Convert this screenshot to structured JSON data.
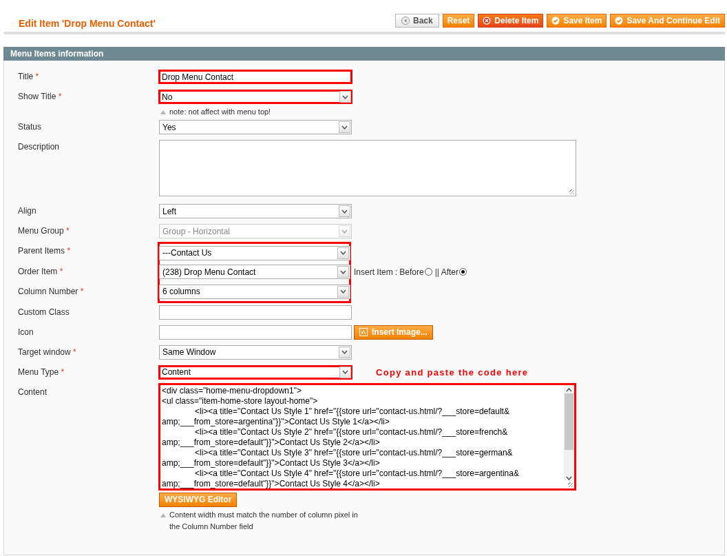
{
  "header": {
    "title": "Edit Item 'Drop Menu Contact'",
    "buttons": [
      {
        "label": "Back",
        "kind": "back"
      },
      {
        "label": "Reset",
        "kind": "plain"
      },
      {
        "label": "Delete Item",
        "kind": "delete"
      },
      {
        "label": "Save Item",
        "kind": "save"
      },
      {
        "label": "Save And Continue Edit",
        "kind": "save"
      }
    ]
  },
  "section": {
    "title": "Menu Items information",
    "rows": [
      {
        "kind": "text",
        "label": "Title",
        "marker": "*",
        "value": "Drop Menu Contact",
        "highlighted": true
      },
      {
        "kind": "select",
        "label": "Show Title",
        "marker": "*",
        "value": "No",
        "highlighted": true,
        "note": "note: not affect with menu top!"
      },
      {
        "kind": "select",
        "label": "Status",
        "value": "Yes",
        "highlighted": false
      },
      {
        "kind": "textarea",
        "label": "Description",
        "highlighted": false
      },
      {
        "kind": "select",
        "label": "Align",
        "value": "Left",
        "highlighted": false
      },
      {
        "kind": "select",
        "label": "Menu Group",
        "marker": "*",
        "value": "Group - Horizontal",
        "highlighted": false,
        "disabled": true
      },
      {
        "kind": "group",
        "highlighted": true,
        "rows": [
          {
            "kind": "select",
            "label": "Parent Items",
            "marker": "*",
            "value": "---Contact Us"
          },
          {
            "kind": "select",
            "label": "Order Item",
            "marker": "*",
            "value": "(238) Drop Menu Contact",
            "insert": {
              "label": "Insert Item :",
              "options": [
                {
                  "label": "Before",
                  "selected": false
                },
                {
                  "label": "|| After",
                  "selected": true
                }
              ]
            }
          },
          {
            "kind": "select",
            "label": "Column Number",
            "marker": "*",
            "value": "6 columns"
          }
        ]
      },
      {
        "kind": "text",
        "label": "Custom Class",
        "value": "",
        "highlighted": false
      },
      {
        "kind": "image",
        "label": "Icon",
        "value": "",
        "highlighted": false,
        "button": "Insert Image..."
      },
      {
        "kind": "select",
        "label": "Target window",
        "marker": "*",
        "value": "Same Window",
        "highlighted": false
      },
      {
        "kind": "select",
        "label": "Menu Type",
        "marker": "*",
        "value": "Content",
        "highlighted": true,
        "annotation": "Copy and paste the code here"
      },
      {
        "kind": "code",
        "label": "Content",
        "highlighted": true,
        "lines": [
          "<div class=\"home-menu-dropdown1\">",
          "<ul class=\"item-home-store layout-home\">",
          "\t<li><a title=\"Contact Us Style 1\" href=\"{{store url=\"contact-us.html/?___store=default&",
          "amp;___from_store=argentina\"}}\">Contact Us Style 1</a></li>",
          "\t<li><a title=\"Contact Us Style 2\" href=\"{{store url=\"contact-us.html/?___store=french&",
          "amp;___from_store=default\"}}\">Contact Us Style 2</a></li>",
          "\t<li><a title=\"Contact Us Style 3\" href=\"{{store url=\"contact-us.html/?___store=german&",
          "amp;___from_store=default\"}}\">Contact Us Style 3</a></li>",
          "\t<li><a title=\"Contact Us Style 4\" href=\"{{store url=\"contact-us.html/?___store=argentina&",
          "amp;___from_store=default\"}}\">Contact Us Style 4</a></li>"
        ],
        "button": "WYSIWYG Editor",
        "note": "Content width must match the number of column pixel in the Column Number field"
      }
    ]
  }
}
